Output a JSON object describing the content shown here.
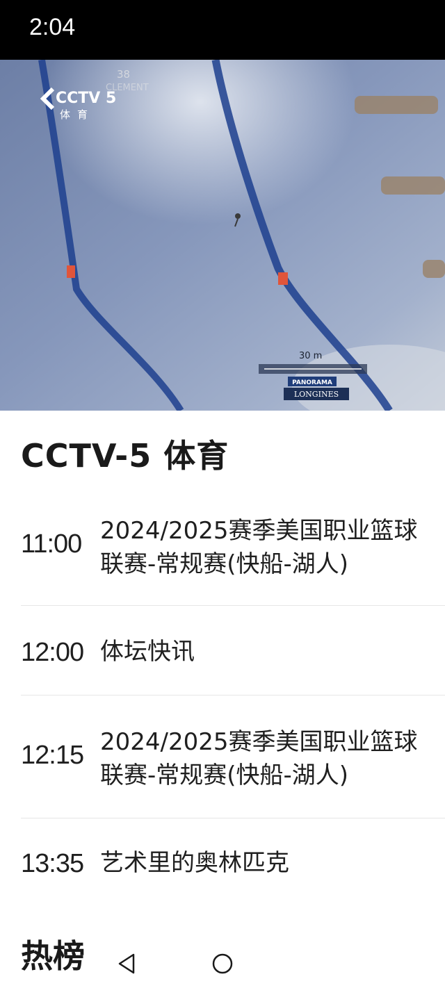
{
  "status_bar": {
    "time": "2:04"
  },
  "video": {
    "logo_text": "CCTV 5",
    "logo_sub": "体育",
    "overlay_number": "38",
    "overlay_text": "CLEMENT",
    "scale_label": "30 m",
    "brand_top": "PANORAMA",
    "brand_bottom": "LONGINES"
  },
  "channel": {
    "title": "CCTV-5 体育"
  },
  "schedule": [
    {
      "time": "11:00",
      "title": "2024/2025赛季美国职业篮球联赛-常规赛(快船-湖人)"
    },
    {
      "time": "12:00",
      "title": "体坛快讯"
    },
    {
      "time": "12:15",
      "title": "2024/2025赛季美国职业篮球联赛-常规赛(快船-湖人)"
    },
    {
      "time": "13:35",
      "title": "艺术里的奥林匹克"
    }
  ],
  "hot_section": {
    "title": "热榜"
  },
  "nav": {
    "back_icon": "back-triangle-icon",
    "home_icon": "home-circle-icon"
  }
}
